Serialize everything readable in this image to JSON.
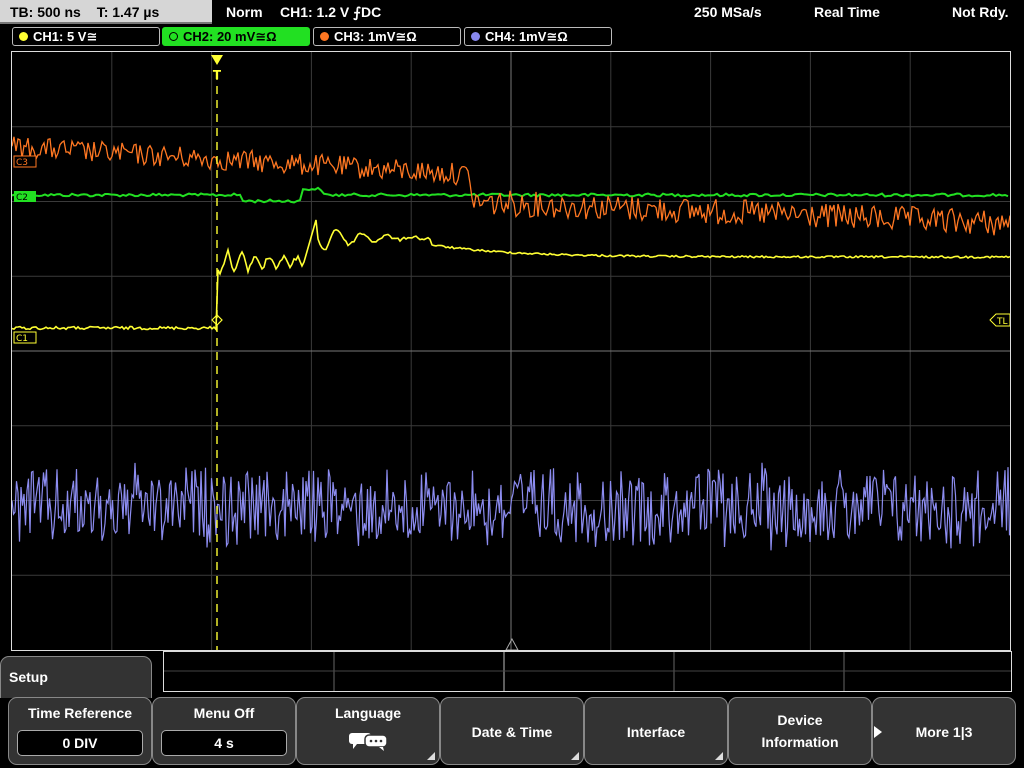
{
  "topbar": {
    "timebase": "TB: 500 ns",
    "trigger_time": "T: 1.47 µs",
    "mode": "Norm",
    "trigger_info": "CH1: 1.2 V ⨍DC",
    "sample_rate": "250 MSa/s",
    "acq_mode": "Real Time",
    "state": "Not Rdy."
  },
  "channels": [
    {
      "label": "CH1: 5 V≅",
      "color": "#ffff33",
      "active": false
    },
    {
      "label": "CH2: 20 mV≅Ω",
      "color": "#22e022",
      "active": true
    },
    {
      "label": "CH3: 1mV≅Ω",
      "color": "#ff7722",
      "active": false
    },
    {
      "label": "CH4: 1mV≅Ω",
      "color": "#8888ee",
      "active": false
    }
  ],
  "markers": {
    "c1": "C1",
    "c2": "C2",
    "c3": "C3",
    "tl": "TL",
    "trigger": "T"
  },
  "menu": {
    "title": "Setup",
    "time_reference": {
      "label": "Time Reference",
      "value": "0 DIV"
    },
    "menu_off": {
      "label": "Menu Off",
      "value": "4 s"
    },
    "language": {
      "label": "Language",
      "icon": "speech-bubbles-icon"
    },
    "date_time": {
      "label": "Date & Time"
    },
    "interface": {
      "label": "Interface"
    },
    "device_info": {
      "line1": "Device",
      "line2": "Information"
    },
    "more": {
      "label": "More 1|3"
    }
  }
}
